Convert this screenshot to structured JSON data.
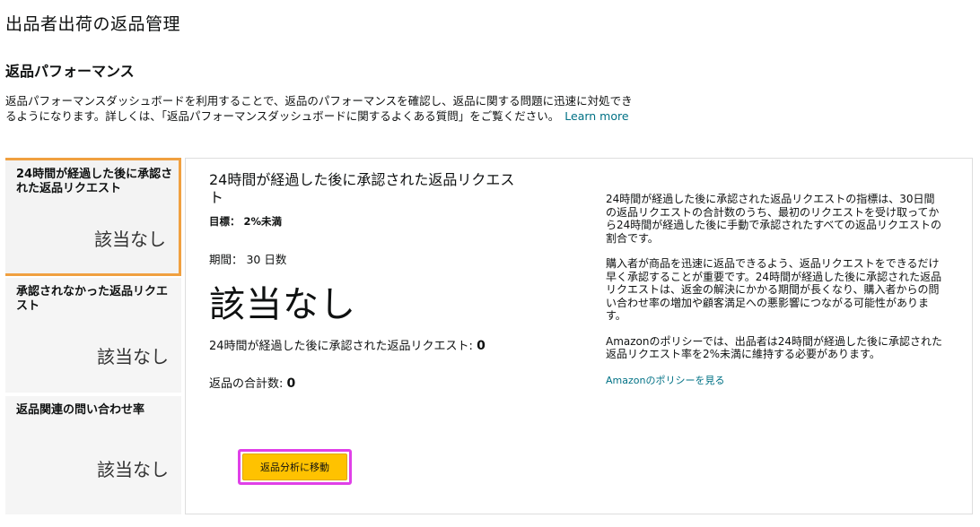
{
  "header": {
    "page_title": "出品者出荷の返品管理",
    "section_title": "返品パフォーマンス",
    "description": "返品パフォーマンスダッシュボードを利用することで、返品のパフォーマンスを確認し、返品に関する問題に迅速に対処できるようになります。詳しくは、「返品パフォーマンスダッシュボードに関するよくある質問」をご覧ください。",
    "learn_more": "Learn more"
  },
  "sidebar": {
    "cards": [
      {
        "label": "24時間が経過した後に承認された返品リクエスト",
        "value": "該当なし"
      },
      {
        "label": "承認されなかった返品リクエスト",
        "value": "該当なし"
      },
      {
        "label": "返品関連の問い合わせ率",
        "value": "該当なし"
      }
    ]
  },
  "main": {
    "title": "24時間が経過した後に承認された返品リクエスト",
    "target": "目標： 2%未満",
    "period": "期間： 30 日数",
    "big_value": "該当なし",
    "row1_label": "24時間が経過した後に承認された返品リクエスト:",
    "row1_value": "0",
    "row2_label": "返品の合計数:",
    "row2_value": "0",
    "button_label": "返品分析に移動"
  },
  "info": {
    "p1": "24時間が経過した後に承認された返品リクエストの指標は、30日間の返品リクエストの合計数のうち、最初のリクエストを受け取ってから24時間が経過した後に手動で承認されたすべての返品リクエストの割合です。",
    "p2": "購入者が商品を迅速に返品できるよう、返品リクエストをできるだけ早く承認することが重要です。24時間が経過した後に承認された返品リクエストは、返金の解決にかかる期間が長くなり、購入者からの問い合わせ率の増加や顧客満足への悪影響につながる可能性があります。",
    "p3": "Amazonのポリシーでは、出品者は24時間が経過した後に承認された返品リクエスト率を2%未満に維持する必要があります。",
    "policy_link": "Amazonのポリシーを見る"
  },
  "colors": {
    "accent": "#f0a040",
    "button": "#ffc200",
    "link": "#007185",
    "highlight": "#e040e8"
  }
}
